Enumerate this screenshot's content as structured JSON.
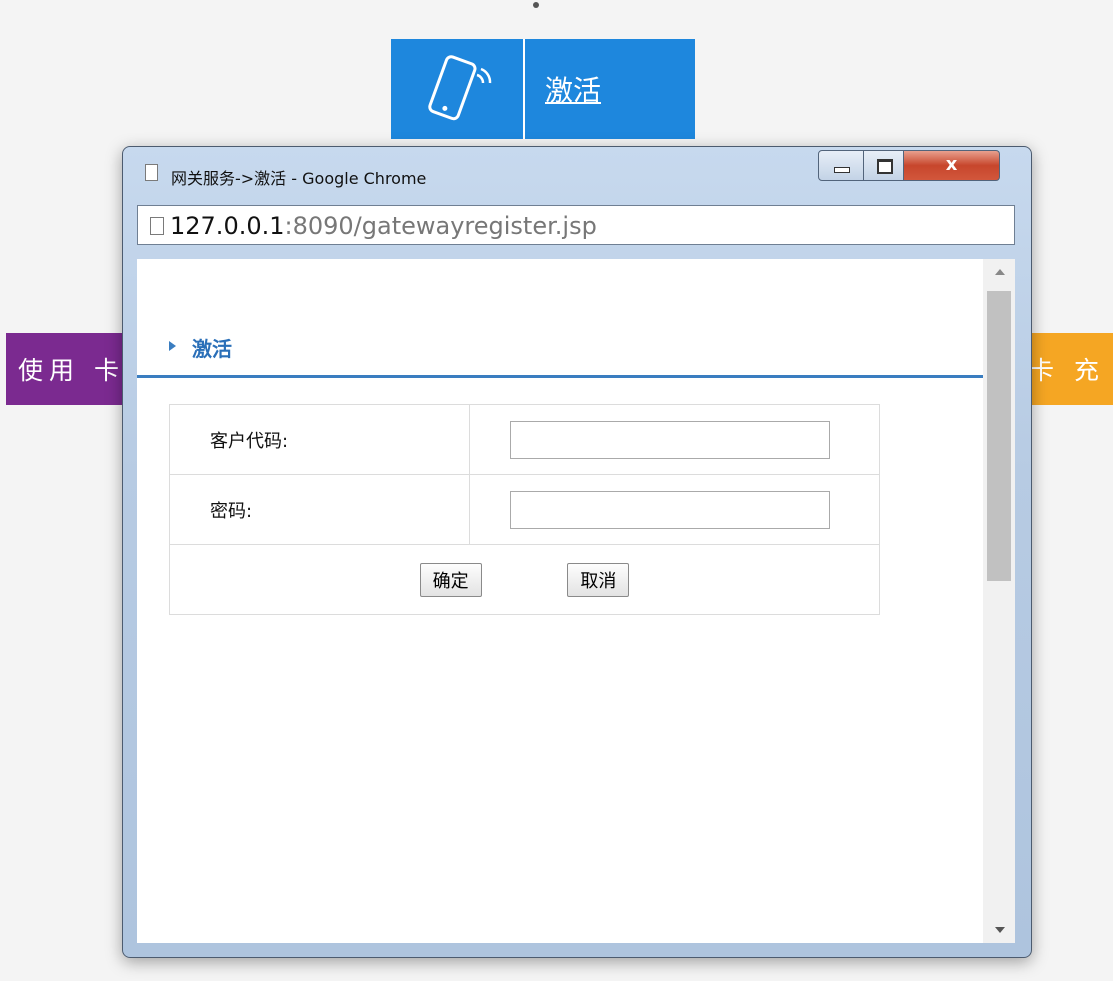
{
  "background": {
    "tiles": {
      "activate_label": "激活",
      "left_label": "使用 卡",
      "right_label": "卡 充",
      "colors": {
        "activate": "#1e87dd",
        "left": "#7b2a90",
        "right": "#f5a623"
      }
    }
  },
  "window": {
    "title": "网关服务->激活 - Google Chrome",
    "address": {
      "host": "127.0.0.1",
      "path": ":8090/gatewayregister.jsp"
    }
  },
  "page": {
    "section_title": "激活",
    "fields": [
      {
        "label": "客户代码:",
        "value": "",
        "placeholder": ""
      },
      {
        "label": "密码:",
        "value": "",
        "placeholder": ""
      }
    ],
    "buttons": {
      "confirm": "确定",
      "cancel": "取消"
    }
  },
  "icons": [
    "phone-signal-icon",
    "page-icon",
    "minimize-icon",
    "maximize-icon",
    "close-icon",
    "triangle-right-icon",
    "scroll-up-icon",
    "scroll-down-icon"
  ],
  "accent_color": "#3a7dc0"
}
